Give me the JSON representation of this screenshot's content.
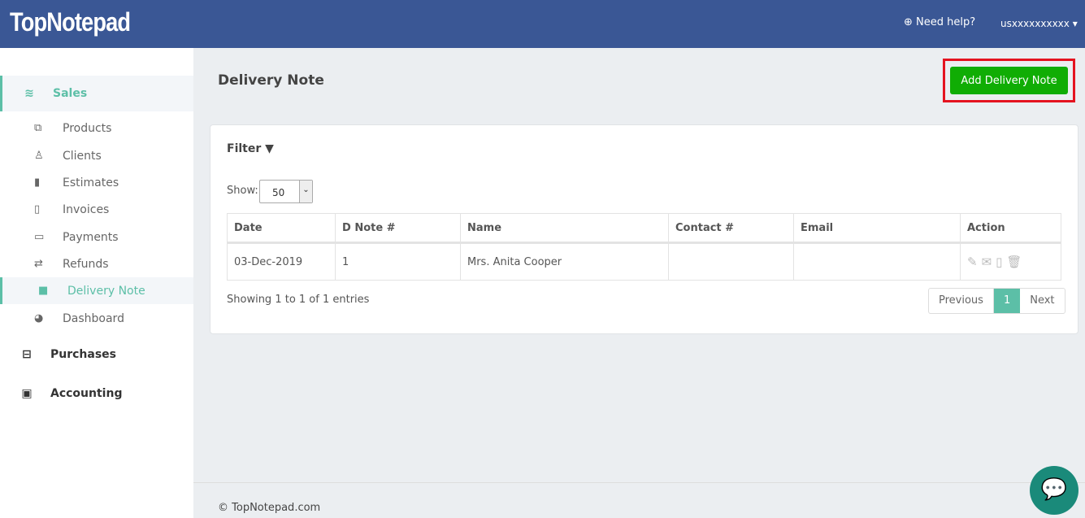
{
  "header": {
    "logo": "TopNotepad",
    "help": "Need help?",
    "user": "usxxxxxxxxxx"
  },
  "sidebar": {
    "sections": [
      {
        "label": "Sales",
        "icon": "layers-icon"
      },
      {
        "label": "Purchases",
        "icon": "minus-square-icon"
      },
      {
        "label": "Accounting",
        "icon": "bar-chart-icon"
      }
    ],
    "items": [
      {
        "label": "Products",
        "icon": "cubes-icon"
      },
      {
        "label": "Clients",
        "icon": "user-icon"
      },
      {
        "label": "Estimates",
        "icon": "file-icon"
      },
      {
        "label": "Invoices",
        "icon": "file-outline-icon"
      },
      {
        "label": "Payments",
        "icon": "credit-card-icon"
      },
      {
        "label": "Refunds",
        "icon": "exchange-icon"
      },
      {
        "label": "Delivery Note",
        "icon": "truck-icon"
      },
      {
        "label": "Dashboard",
        "icon": "dashboard-icon"
      }
    ]
  },
  "page": {
    "title": "Delivery Note",
    "add_button": "Add Delivery Note",
    "filter": "Filter",
    "show_label": "Show:",
    "show_value": "50",
    "columns": [
      "Date",
      "D Note #",
      "Name",
      "Contact #",
      "Email",
      "Action"
    ],
    "rows": [
      {
        "date": "03-Dec-2019",
        "number": "1",
        "name": "Mrs. Anita Cooper",
        "contact": "",
        "email": ""
      }
    ],
    "info": "Showing 1 to 1 of 1 entries",
    "pagination": {
      "prev": "Previous",
      "current": "1",
      "next": "Next"
    }
  },
  "footer": "© TopNotepad.com",
  "colors": {
    "header": "#3a5795",
    "accent": "#5cbfa7",
    "add_button": "#10ad04",
    "highlight": "#e4131f"
  }
}
